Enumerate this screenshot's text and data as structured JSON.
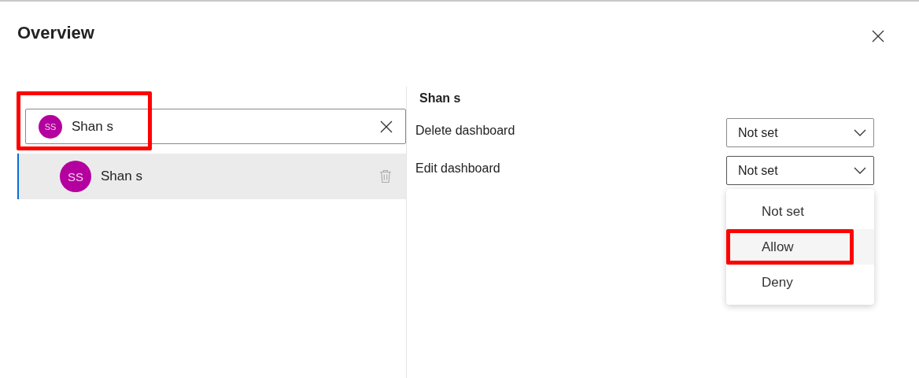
{
  "dialog": {
    "title": "Overview"
  },
  "search": {
    "avatar_initials": "SS",
    "value": "Shan s",
    "highlighted": true
  },
  "users": [
    {
      "initials": "SS",
      "name": "Shan s",
      "selected": true
    }
  ],
  "details": {
    "name": "Shan s",
    "permissions": [
      {
        "label": "Delete dashboard",
        "value": "Not set",
        "expanded": false
      },
      {
        "label": "Edit dashboard",
        "value": "Not set",
        "expanded": true
      }
    ]
  },
  "menu": [
    {
      "label": "Not set",
      "hovered": false,
      "highlighted": false
    },
    {
      "label": "Allow",
      "hovered": true,
      "highlighted": true
    },
    {
      "label": "Deny",
      "hovered": false,
      "highlighted": false
    }
  ]
}
